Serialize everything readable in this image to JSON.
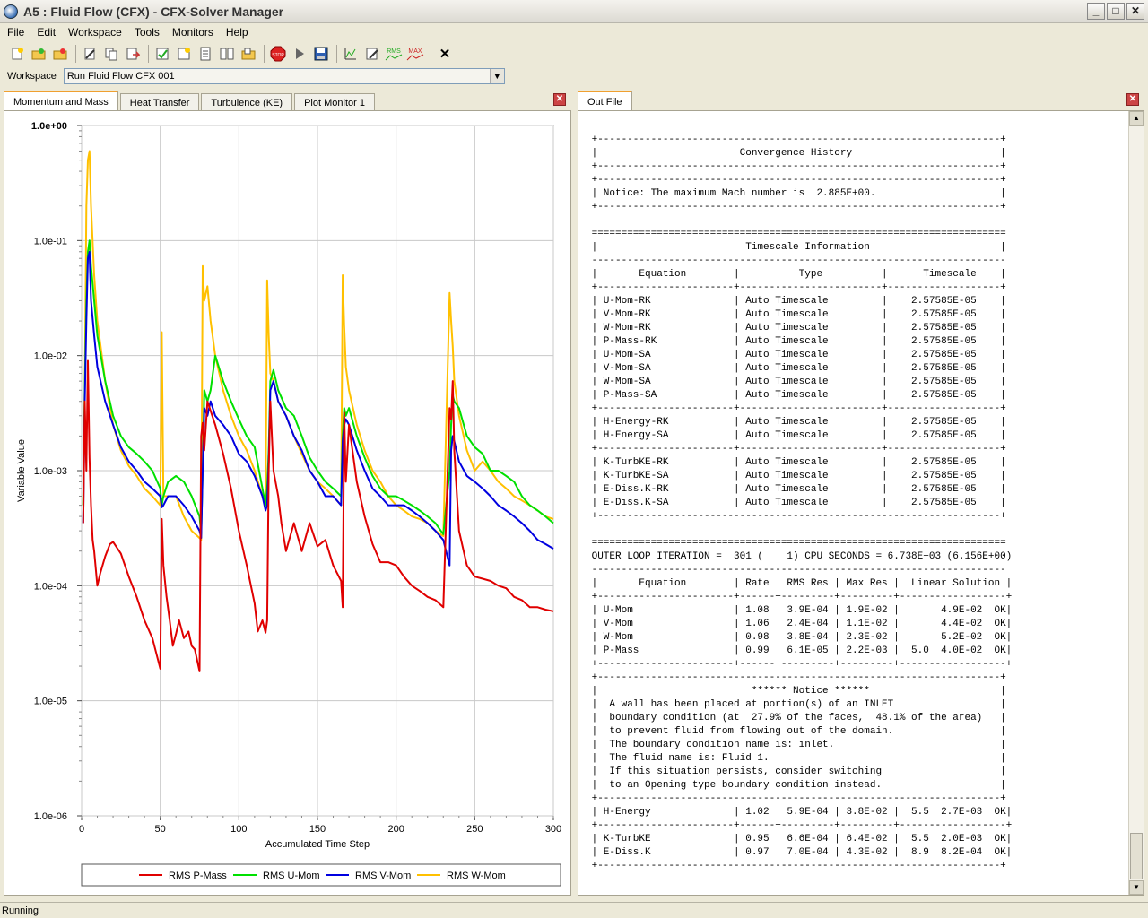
{
  "window": {
    "title": "A5 : Fluid Flow (CFX) - CFX-Solver Manager"
  },
  "menu": [
    "File",
    "Edit",
    "Workspace",
    "Tools",
    "Monitors",
    "Help"
  ],
  "toolbar": {
    "rms_label": "RMS",
    "max_label": "MAX"
  },
  "workspace": {
    "label": "Workspace",
    "value": "Run Fluid Flow CFX 001"
  },
  "left_tabs": [
    "Momentum and Mass",
    "Heat Transfer",
    "Turbulence (KE)",
    "Plot Monitor 1"
  ],
  "right_tabs": [
    "Out File"
  ],
  "status": {
    "text": "Running"
  },
  "colors": {
    "p_mass": "#e00000",
    "u_mom": "#00e000",
    "v_mom": "#0000e0",
    "w_mom": "#ffc000"
  },
  "chart_data": {
    "type": "line",
    "xlabel": "Accumulated Time Step",
    "ylabel": "Variable Value",
    "xlim": [
      0,
      300
    ],
    "ylim": [
      1e-06,
      1
    ],
    "yscale": "log",
    "grid": true,
    "legend_position": "bottom",
    "x_ticks": [
      "0",
      "50",
      "100",
      "150",
      "200",
      "250",
      "300"
    ],
    "y_ticks": [
      "1.0e+00",
      "1.0e-01",
      "1.0e-02",
      "1.0e-03",
      "1.0e-04",
      "1.0e-05",
      "1.0e-06"
    ],
    "series": [
      {
        "name": "RMS P-Mass",
        "x": [
          1,
          2,
          3,
          4,
          5,
          6,
          7,
          8,
          10,
          12,
          15,
          18,
          20,
          25,
          30,
          35,
          40,
          45,
          50,
          51,
          52,
          54,
          56,
          58,
          60,
          62,
          65,
          68,
          70,
          72,
          75,
          76,
          77,
          78,
          80,
          85,
          90,
          95,
          100,
          105,
          110,
          112,
          115,
          117,
          118,
          119,
          120,
          122,
          125,
          127,
          130,
          135,
          140,
          145,
          150,
          155,
          160,
          165,
          166,
          167,
          168,
          170,
          175,
          180,
          185,
          190,
          195,
          200,
          205,
          210,
          215,
          220,
          225,
          230,
          234,
          235,
          236,
          237,
          240,
          245,
          250,
          255,
          260,
          265,
          270,
          275,
          280,
          285,
          290,
          295,
          300
        ],
        "y": [
          0.00035,
          0.004,
          0.001,
          0.009,
          0.0013,
          0.0005,
          0.00025,
          0.0002,
          0.0001,
          0.00013,
          0.00018,
          0.00023,
          0.00024,
          0.00019,
          0.00012,
          8e-05,
          5e-05,
          3.5e-05,
          1.9e-05,
          0.00038,
          0.00015,
          8e-05,
          5e-05,
          3e-05,
          3.8e-05,
          5e-05,
          3.5e-05,
          4e-05,
          3e-05,
          2.8e-05,
          1.8e-05,
          0.002,
          0.0026,
          0.0015,
          0.004,
          0.0025,
          0.0014,
          0.0007,
          0.0003,
          0.00015,
          7e-05,
          4e-05,
          5e-05,
          3.9e-05,
          5e-05,
          0.001,
          0.004,
          0.001,
          0.0006,
          0.00035,
          0.0002,
          0.00035,
          0.0002,
          0.00035,
          0.00022,
          0.00025,
          0.00015,
          0.00011,
          6.5e-05,
          0.0032,
          0.0008,
          0.0025,
          0.0008,
          0.0004,
          0.00023,
          0.00016,
          0.00016,
          0.00015,
          0.00012,
          0.0001,
          9e-05,
          8e-05,
          7.5e-05,
          6.5e-05,
          0.0035,
          0.0028,
          0.006,
          0.0015,
          0.0003,
          0.00015,
          0.00012,
          0.000115,
          0.00011,
          0.0001,
          9.5e-05,
          8e-05,
          7.5e-05,
          6.5e-05,
          6.5e-05,
          6.2e-05,
          6e-05
        ]
      },
      {
        "name": "RMS U-Mom",
        "x": [
          1,
          2,
          3,
          4,
          5,
          6,
          8,
          10,
          15,
          20,
          25,
          30,
          35,
          40,
          45,
          50,
          51,
          52,
          55,
          60,
          65,
          70,
          75,
          76,
          77,
          78,
          80,
          82,
          85,
          90,
          95,
          100,
          105,
          110,
          115,
          117,
          118,
          119,
          120,
          122,
          125,
          130,
          135,
          140,
          145,
          150,
          155,
          160,
          165,
          166,
          167,
          168,
          170,
          175,
          180,
          185,
          190,
          195,
          200,
          205,
          210,
          215,
          220,
          225,
          230,
          234,
          235,
          236,
          237,
          240,
          245,
          250,
          255,
          260,
          265,
          270,
          275,
          280,
          285,
          290,
          295,
          300
        ],
        "y": [
          0.0005,
          0.005,
          0.03,
          0.08,
          0.1,
          0.06,
          0.03,
          0.015,
          0.006,
          0.003,
          0.002,
          0.0016,
          0.0014,
          0.0012,
          0.001,
          0.0007,
          0.0005,
          0.0006,
          0.0008,
          0.0009,
          0.0008,
          0.0006,
          0.0004,
          0.00028,
          0.001,
          0.005,
          0.004,
          0.005,
          0.01,
          0.006,
          0.004,
          0.0028,
          0.002,
          0.0016,
          0.0007,
          0.0005,
          0.0007,
          0.0015,
          0.006,
          0.0075,
          0.005,
          0.0035,
          0.003,
          0.002,
          0.0013,
          0.001,
          0.0008,
          0.0007,
          0.0006,
          0.002,
          0.0035,
          0.003,
          0.0035,
          0.002,
          0.0013,
          0.0009,
          0.0007,
          0.0006,
          0.0006,
          0.00055,
          0.0005,
          0.00045,
          0.0004,
          0.00035,
          0.00028,
          0.001,
          0.0025,
          0.0045,
          0.004,
          0.0035,
          0.002,
          0.0016,
          0.0014,
          0.001,
          0.001,
          0.0009,
          0.0008,
          0.0006,
          0.0005,
          0.00045,
          0.0004,
          0.00035
        ]
      },
      {
        "name": "RMS V-Mom",
        "x": [
          1,
          2,
          3,
          4,
          5,
          6,
          8,
          10,
          15,
          20,
          25,
          30,
          35,
          40,
          45,
          50,
          51,
          52,
          55,
          60,
          65,
          70,
          75,
          76,
          77,
          78,
          80,
          82,
          85,
          90,
          95,
          100,
          105,
          110,
          115,
          117,
          118,
          119,
          120,
          122,
          125,
          130,
          135,
          140,
          145,
          150,
          155,
          160,
          165,
          166,
          167,
          168,
          170,
          175,
          180,
          185,
          190,
          195,
          200,
          205,
          210,
          215,
          220,
          225,
          230,
          234,
          235,
          236,
          237,
          240,
          245,
          250,
          255,
          260,
          265,
          270,
          275,
          280,
          285,
          290,
          295,
          300
        ],
        "y": [
          0.00035,
          0.004,
          0.02,
          0.07,
          0.08,
          0.03,
          0.015,
          0.008,
          0.004,
          0.0025,
          0.0016,
          0.0012,
          0.001,
          0.0008,
          0.0007,
          0.0006,
          0.00048,
          0.0005,
          0.0006,
          0.0006,
          0.0005,
          0.0004,
          0.0003,
          0.00026,
          0.001,
          0.0035,
          0.003,
          0.004,
          0.003,
          0.0025,
          0.002,
          0.0014,
          0.0012,
          0.0009,
          0.0006,
          0.00045,
          0.0005,
          0.0012,
          0.005,
          0.006,
          0.004,
          0.003,
          0.002,
          0.0015,
          0.001,
          0.0008,
          0.0006,
          0.0006,
          0.0005,
          0.0018,
          0.0025,
          0.0028,
          0.0025,
          0.0015,
          0.001,
          0.0007,
          0.0006,
          0.0005,
          0.0005,
          0.0005,
          0.00045,
          0.0004,
          0.00035,
          0.0003,
          0.00025,
          0.00015,
          0.0015,
          0.002,
          0.0018,
          0.0012,
          0.0009,
          0.0008,
          0.0007,
          0.0006,
          0.0005,
          0.00045,
          0.0004,
          0.00035,
          0.0003,
          0.00025,
          0.00023,
          0.00021
        ]
      },
      {
        "name": "RMS W-Mom",
        "x": [
          1,
          2,
          3,
          4,
          5,
          6,
          8,
          10,
          15,
          20,
          25,
          30,
          35,
          40,
          45,
          50,
          51,
          52,
          55,
          60,
          65,
          70,
          75,
          76,
          77,
          78,
          80,
          82,
          85,
          90,
          95,
          100,
          105,
          110,
          115,
          117,
          118,
          119,
          120,
          122,
          125,
          130,
          135,
          140,
          145,
          150,
          155,
          160,
          165,
          166,
          167,
          168,
          170,
          175,
          180,
          185,
          190,
          195,
          200,
          205,
          210,
          215,
          220,
          225,
          230,
          234,
          235,
          236,
          237,
          240,
          245,
          250,
          255,
          260,
          265,
          270,
          275,
          280,
          285,
          290,
          295,
          300
        ],
        "y": [
          0.0005,
          0.005,
          0.2,
          0.5,
          0.6,
          0.2,
          0.05,
          0.02,
          0.006,
          0.0025,
          0.0015,
          0.0011,
          0.0009,
          0.0007,
          0.0006,
          0.0005,
          0.016,
          0.0006,
          0.0006,
          0.0006,
          0.0004,
          0.0003,
          0.00026,
          0.00025,
          0.06,
          0.03,
          0.04,
          0.02,
          0.01,
          0.005,
          0.003,
          0.002,
          0.0015,
          0.001,
          0.0006,
          0.0005,
          0.045,
          0.015,
          0.007,
          0.006,
          0.004,
          0.003,
          0.002,
          0.0014,
          0.001,
          0.0008,
          0.0007,
          0.0006,
          0.0005,
          0.05,
          0.018,
          0.008,
          0.005,
          0.0025,
          0.0015,
          0.001,
          0.0008,
          0.0006,
          0.0005,
          0.00045,
          0.0004,
          0.00038,
          0.00035,
          0.0003,
          0.00027,
          0.035,
          0.02,
          0.012,
          0.006,
          0.003,
          0.0015,
          0.001,
          0.0012,
          0.001,
          0.0008,
          0.0007,
          0.0006,
          0.00055,
          0.0005,
          0.00045,
          0.0004,
          0.00038
        ]
      }
    ]
  },
  "outfile_lines": [
    "",
    " +--------------------------------------------------------------------+",
    " |                        Convergence History                         |",
    " +--------------------------------------------------------------------+",
    " +--------------------------------------------------------------------+",
    " | Notice: The maximum Mach number is  2.885E+00.                     |",
    " +--------------------------------------------------------------------+",
    "",
    " ======================================================================",
    " |                         Timescale Information                      |",
    " ----------------------------------------------------------------------",
    " |       Equation        |          Type          |      Timescale    |",
    " +-----------------------+------------------------+-------------------+",
    " | U-Mom-RK              | Auto Timescale         |    2.57585E-05    |",
    " | V-Mom-RK              | Auto Timescale         |    2.57585E-05    |",
    " | W-Mom-RK              | Auto Timescale         |    2.57585E-05    |",
    " | P-Mass-RK             | Auto Timescale         |    2.57585E-05    |",
    " | U-Mom-SA              | Auto Timescale         |    2.57585E-05    |",
    " | V-Mom-SA              | Auto Timescale         |    2.57585E-05    |",
    " | W-Mom-SA              | Auto Timescale         |    2.57585E-05    |",
    " | P-Mass-SA             | Auto Timescale         |    2.57585E-05    |",
    " +-----------------------+------------------------+-------------------+",
    " | H-Energy-RK           | Auto Timescale         |    2.57585E-05    |",
    " | H-Energy-SA           | Auto Timescale         |    2.57585E-05    |",
    " +-----------------------+------------------------+-------------------+",
    " | K-TurbKE-RK           | Auto Timescale         |    2.57585E-05    |",
    " | K-TurbKE-SA           | Auto Timescale         |    2.57585E-05    |",
    " | E-Diss.K-RK           | Auto Timescale         |    2.57585E-05    |",
    " | E-Diss.K-SA           | Auto Timescale         |    2.57585E-05    |",
    " +--------------------------------------------------------------------+",
    "",
    " ======================================================================",
    " OUTER LOOP ITERATION =  301 (    1) CPU SECONDS = 6.738E+03 (6.156E+00)",
    " ----------------------------------------------------------------------",
    " |       Equation        | Rate | RMS Res | Max Res |  Linear Solution |",
    " +-----------------------+------+---------+---------+------------------+",
    " | U-Mom                 | 1.08 | 3.9E-04 | 1.9E-02 |       4.9E-02  OK|",
    " | V-Mom                 | 1.06 | 2.4E-04 | 1.1E-02 |       4.4E-02  OK|",
    " | W-Mom                 | 0.98 | 3.8E-04 | 2.3E-02 |       5.2E-02  OK|",
    " | P-Mass                | 0.99 | 6.1E-05 | 2.2E-03 |  5.0  4.0E-02  OK|",
    " +-----------------------+------+---------+---------+------------------+",
    " +--------------------------------------------------------------------+",
    " |                          ****** Notice ******                      |",
    " |  A wall has been placed at portion(s) of an INLET                  |",
    " |  boundary condition (at  27.9% of the faces,  48.1% of the area)   |",
    " |  to prevent fluid from flowing out of the domain.                  |",
    " |  The boundary condition name is: inlet.                            |",
    " |  The fluid name is: Fluid 1.                                       |",
    " |  If this situation persists, consider switching                    |",
    " |  to an Opening type boundary condition instead.                    |",
    " +--------------------------------------------------------------------+",
    " | H-Energy              | 1.02 | 5.9E-04 | 3.8E-02 |  5.5  2.7E-03  OK|",
    " +-----------------------+------+---------+---------+------------------+",
    " | K-TurbKE              | 0.95 | 6.6E-04 | 6.4E-02 |  5.5  2.0E-03  OK|",
    " | E-Diss.K              | 0.97 | 7.0E-04 | 4.3E-02 |  8.9  8.2E-04  OK|",
    " +--------------------------------------------------------------------+"
  ]
}
